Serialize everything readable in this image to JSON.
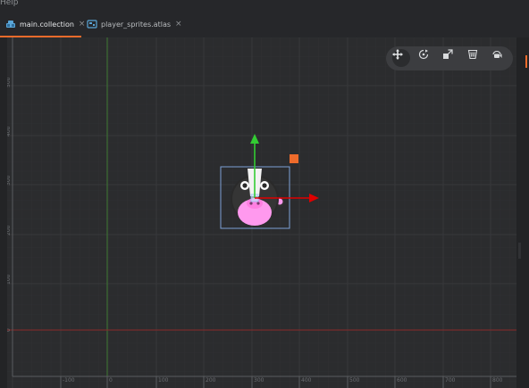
{
  "menubar": {
    "help_label": "Help"
  },
  "tabs": [
    {
      "label": "main.collection",
      "close": "×",
      "icon": "collection-icon",
      "active": true
    },
    {
      "label": "player_sprites.atlas",
      "close": "×",
      "icon": "atlas-icon",
      "active": false
    }
  ],
  "colors": {
    "accent": "#ee6b2b",
    "x_axis": "#e00000",
    "y_axis": "#33cc33",
    "origin_x_line": "#8b2a2a",
    "origin_y_line": "#3f7a34",
    "selection": "#7ea1d6",
    "pig_skin": "#ff99ee",
    "pig_face": "#2a2a2a"
  },
  "toolbar": [
    {
      "icon": "move-tool-icon",
      "active": true
    },
    {
      "icon": "rotate-tool-icon",
      "active": false
    },
    {
      "icon": "scale-tool-icon",
      "active": false
    },
    {
      "icon": "visibility-filter-icon",
      "active": false
    },
    {
      "icon": "camera-perspective-icon",
      "active": false
    }
  ],
  "ruler_x": [
    "-100",
    "0",
    "100",
    "200",
    "300",
    "400",
    "500",
    "600",
    "700",
    "800"
  ],
  "ruler_y": [
    "500",
    "400",
    "300",
    "200",
    "100",
    "0"
  ]
}
